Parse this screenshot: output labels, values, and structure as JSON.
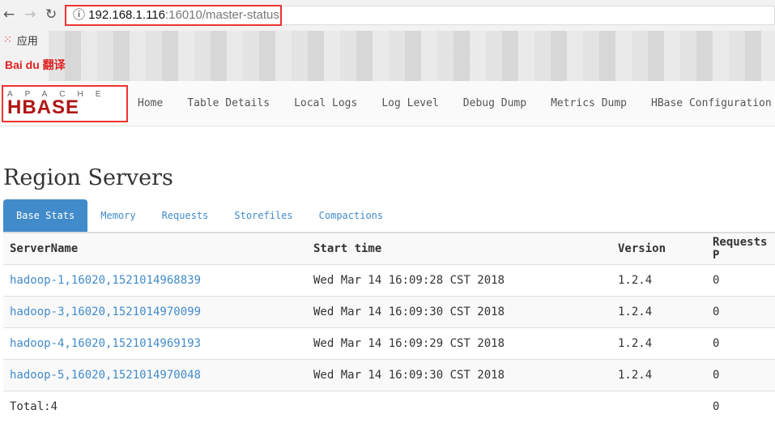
{
  "browser": {
    "url_host": "192.168.1.116",
    "url_rest": ":16010/master-status",
    "bookmark_apps": "应用",
    "bookmark_baidu": "Bai du 翻译"
  },
  "logo": {
    "top": "APACHE",
    "main": "HBASE"
  },
  "nav": [
    "Home",
    "Table Details",
    "Local Logs",
    "Log Level",
    "Debug Dump",
    "Metrics Dump",
    "HBase Configuration"
  ],
  "title": "Region Servers",
  "tabs": [
    "Base Stats",
    "Memory",
    "Requests",
    "Storefiles",
    "Compactions"
  ],
  "table": {
    "headers": [
      "ServerName",
      "Start time",
      "Version",
      "Requests P"
    ],
    "rows": [
      [
        "hadoop-1,16020,1521014968839",
        "Wed Mar 14 16:09:28 CST 2018",
        "1.2.4",
        "0"
      ],
      [
        "hadoop-3,16020,1521014970099",
        "Wed Mar 14 16:09:30 CST 2018",
        "1.2.4",
        "0"
      ],
      [
        "hadoop-4,16020,1521014969193",
        "Wed Mar 14 16:09:29 CST 2018",
        "1.2.4",
        "0"
      ],
      [
        "hadoop-5,16020,1521014970048",
        "Wed Mar 14 16:09:30 CST 2018",
        "1.2.4",
        "0"
      ]
    ],
    "total": "Total:4",
    "total_requests": "0"
  }
}
